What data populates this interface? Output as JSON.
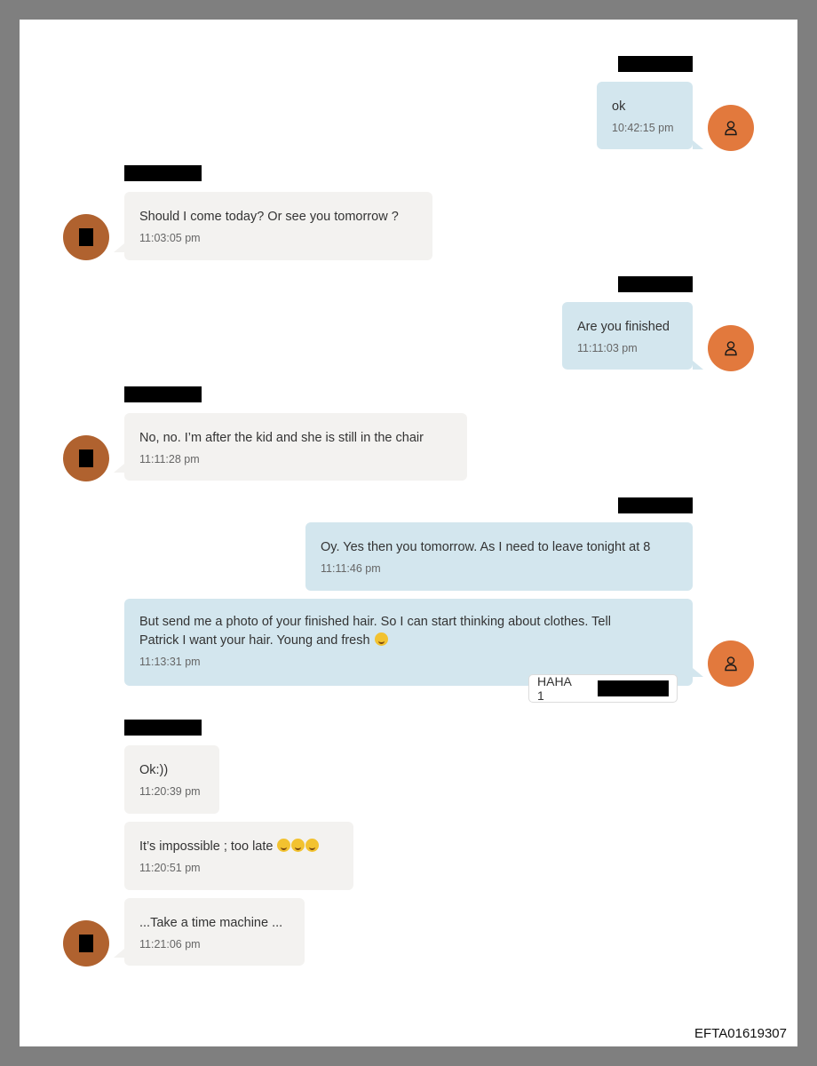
{
  "messages": [
    {
      "text": "ok",
      "time": "10:42:15 pm"
    },
    {
      "text": "Should I come today? Or see you tomorrow ?",
      "time": "11:03:05 pm"
    },
    {
      "text": "Are you finished",
      "time": "11:11:03 pm"
    },
    {
      "text": "No, no. I’m after the kid and she is still in the chair",
      "time": "11:11:28 pm"
    },
    {
      "text": "Oy. Yes then you tomorrow. As I need to leave tonight at 8",
      "time": "11:11:46 pm"
    },
    {
      "text_line1": "But send me a photo of your finished hair. So I can start thinking about clothes.   Tell",
      "text_line2": "Patrick I want your hair. Young and fresh",
      "time": "11:13:31 pm"
    },
    {
      "text": "Ok:))",
      "time": "11:20:39 pm"
    },
    {
      "text": "It’s impossible ; too late",
      "time": "11:20:51 pm"
    },
    {
      "text": "...Take a time machine ...",
      "time": "11:21:06 pm"
    }
  ],
  "reaction": {
    "label": "HAHA 1"
  },
  "footer": {
    "doc_id": "EFTA01619307"
  },
  "icons": {
    "outgoing_avatar": "person-icon",
    "emoji_smile": "smiling-face-icon",
    "emoji_laugh": "tears-of-joy-icon"
  },
  "colors": {
    "outgoing_bubble": "#d3e6ee",
    "incoming_bubble": "#f3f2f0",
    "outgoing_avatar": "#e2793d",
    "incoming_avatar": "#b0622f"
  }
}
